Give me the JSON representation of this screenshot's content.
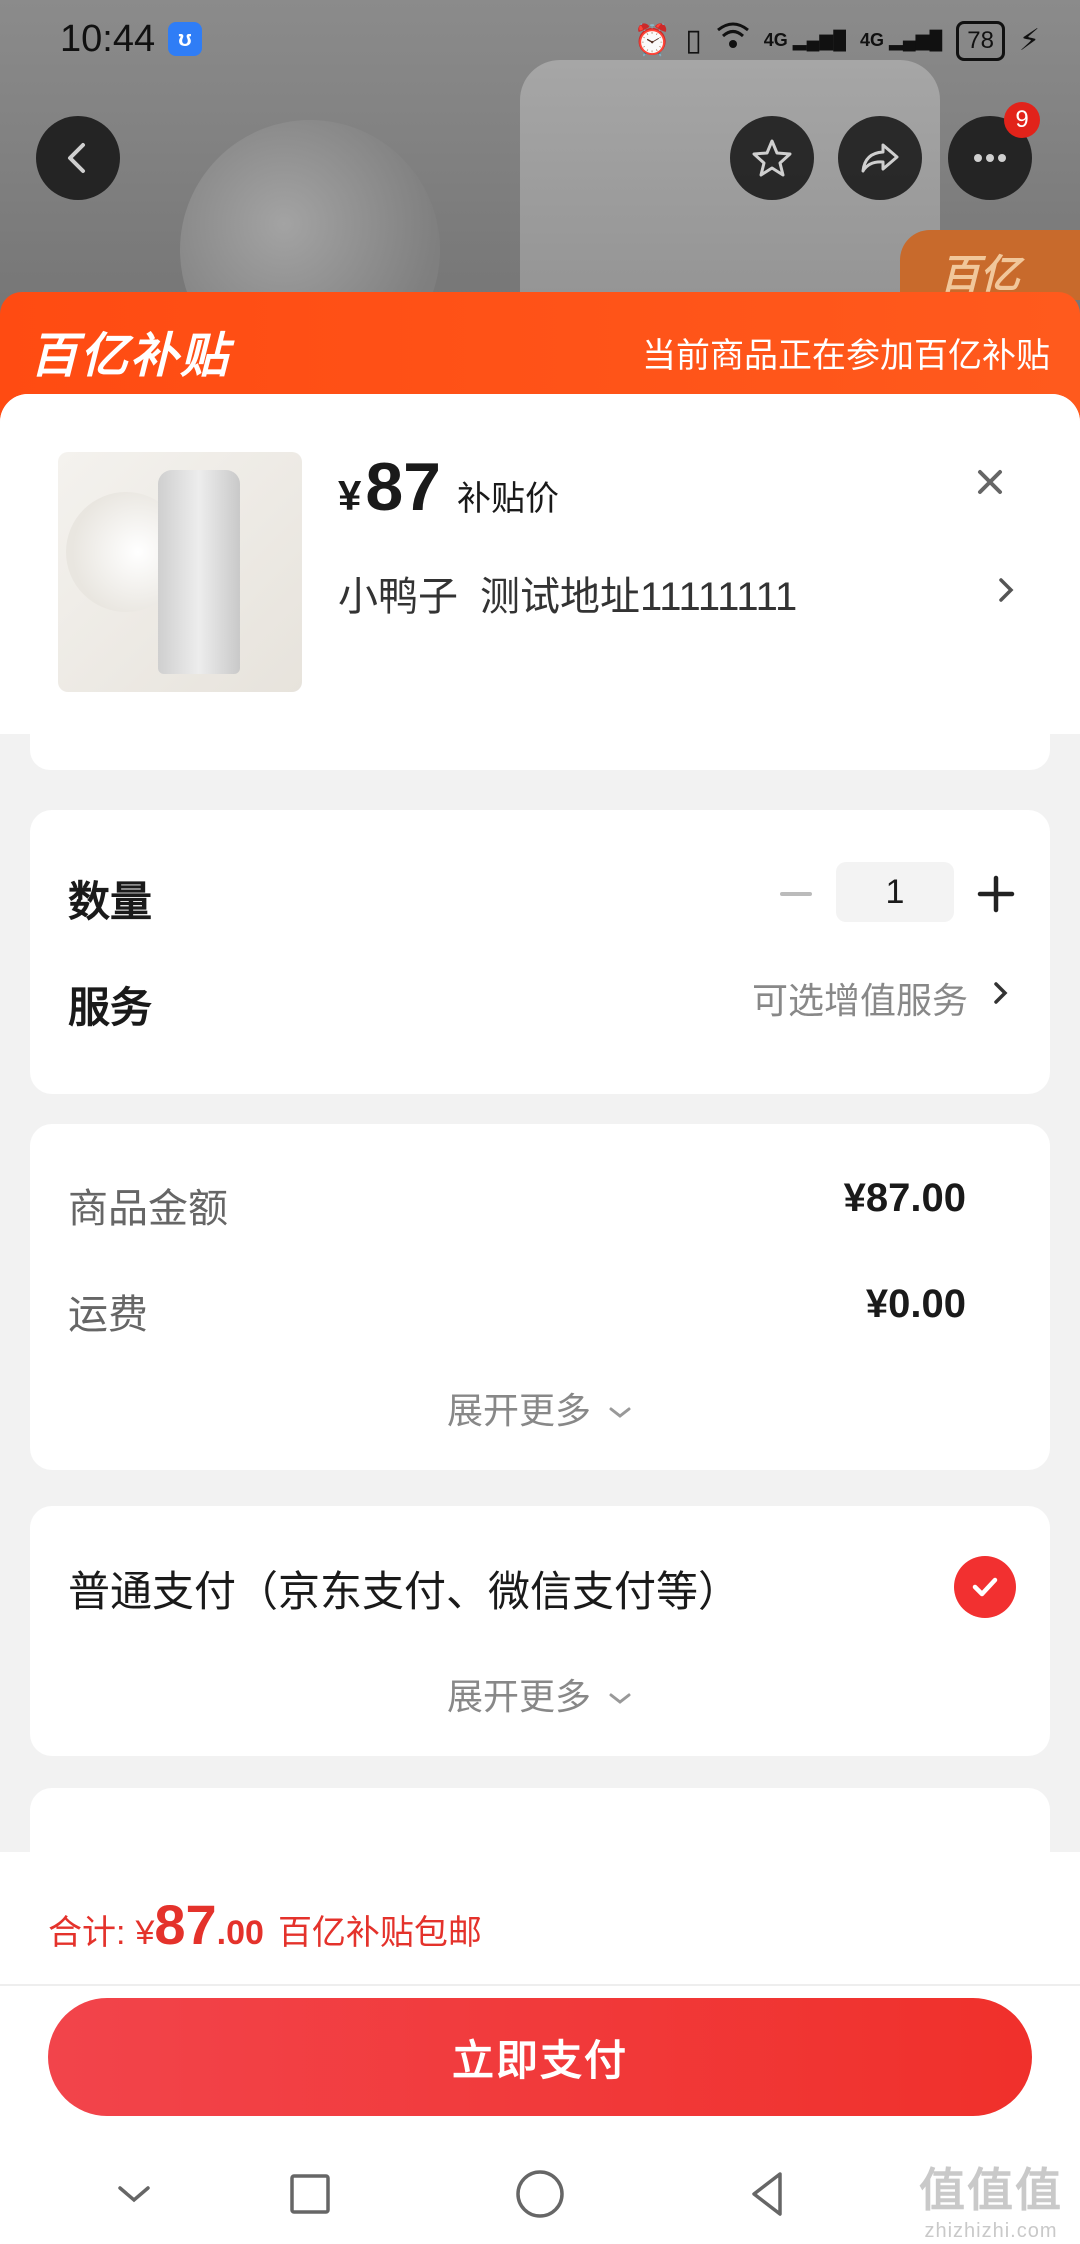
{
  "status_bar": {
    "time": "10:44",
    "battery": "78",
    "network_a": "4G",
    "network_b": "4G"
  },
  "nav": {
    "cart_count": "9"
  },
  "banner": {
    "notice": "当前商品正在参加百亿补贴",
    "logo_text": "百亿补贴"
  },
  "product": {
    "price_symbol": "¥",
    "price": "87",
    "price_tag": "补贴价",
    "recipient": "小鸭子",
    "address": "测试地址11111111"
  },
  "quantity": {
    "label": "数量",
    "value": "1"
  },
  "service": {
    "label": "服务",
    "hint": "可选增值服务"
  },
  "amounts": {
    "goods_label": "商品金额",
    "goods_value": "¥87.00",
    "shipping_label": "运费",
    "shipping_value": "¥0.00",
    "more_label": "展开更多"
  },
  "payment": {
    "method": "普通支付（京东支付、微信支付等）",
    "more_label": "展开更多"
  },
  "footer": {
    "total_label": "合计:",
    "total_symbol": "¥",
    "total_int": "87",
    "total_dec": ".00",
    "total_note": "百亿补贴包邮",
    "pay_button": "立即支付"
  },
  "watermark": {
    "big": "值值值",
    "small": "zhizhizhi.com"
  }
}
